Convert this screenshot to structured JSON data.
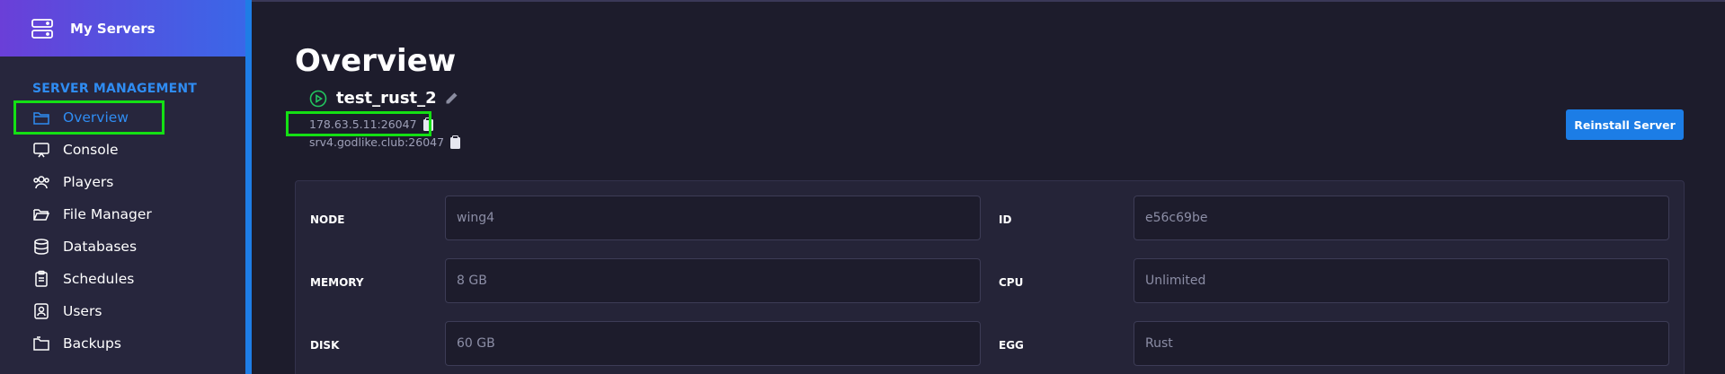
{
  "sidebar": {
    "brand_label": "My Servers",
    "section_title": "SERVER MANAGEMENT",
    "items": [
      {
        "label": "Overview",
        "icon": "folder-icon",
        "active": true
      },
      {
        "label": "Console",
        "icon": "console-icon"
      },
      {
        "label": "Players",
        "icon": "users-group-icon"
      },
      {
        "label": "File Manager",
        "icon": "folder-open-icon"
      },
      {
        "label": "Databases",
        "icon": "database-icon"
      },
      {
        "label": "Schedules",
        "icon": "clipboard-icon"
      },
      {
        "label": "Users",
        "icon": "user-badge-icon"
      },
      {
        "label": "Backups",
        "icon": "backup-folder-icon"
      }
    ]
  },
  "main": {
    "title": "Overview",
    "server_name": "test_rust_2",
    "address_ip": "178.63.5.11:26047",
    "address_host": "srv4.godlike.club:26047",
    "reinstall_label": "Reinstall Server",
    "fields": [
      {
        "label": "NODE",
        "value": "wing4"
      },
      {
        "label": "ID",
        "value": "e56c69be"
      },
      {
        "label": "MEMORY",
        "value": "8 GB"
      },
      {
        "label": "CPU",
        "value": "Unlimited"
      },
      {
        "label": "DISK",
        "value": "60 GB"
      },
      {
        "label": "EGG",
        "value": "Rust"
      }
    ]
  },
  "colors": {
    "accent": "#1c7de6",
    "active_nav": "#2f8cf2",
    "highlight": "#14e014",
    "status_running": "#22c55e"
  }
}
